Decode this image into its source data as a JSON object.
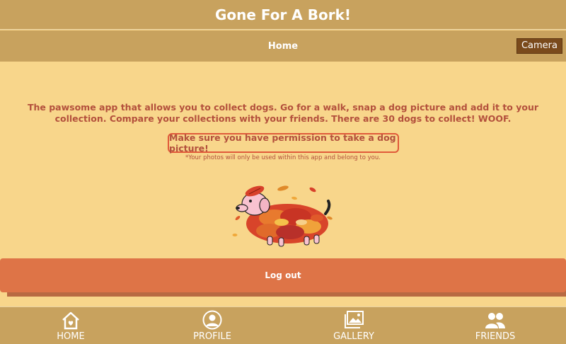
{
  "app": {
    "title": "Gone For A Bork!"
  },
  "subnav": {
    "current": "Home",
    "camera_label": "Camera"
  },
  "main": {
    "intro_text": "The pawsome app that allows you to collect dogs. Go for a walk, snap a dog picture and add it to your collection. Compare your collections with your friends. There are 30 dogs to collect! WOOF.",
    "permission_label": "Make sure you have permission to take a dog picture!",
    "disclaimer": "*Your photos will only be used within this app and belong to you.",
    "logout_label": "Log out"
  },
  "tabbar": {
    "items": [
      {
        "label": "HOME",
        "icon": "home-icon"
      },
      {
        "label": "PROFILE",
        "icon": "profile-icon"
      },
      {
        "label": "GALLERY",
        "icon": "gallery-icon"
      },
      {
        "label": "FRIENDS",
        "icon": "friends-icon"
      }
    ]
  },
  "colors": {
    "background": "#f8d68b",
    "bar": "#c8a25e",
    "accent_text": "#b3503c",
    "logout": "#de7447",
    "camera": "#7a4a1c"
  }
}
